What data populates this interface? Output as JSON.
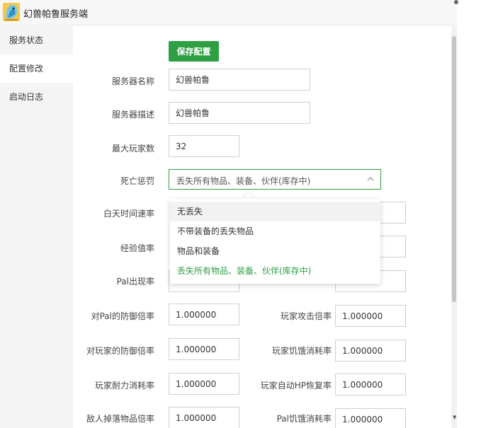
{
  "app": {
    "title": "幻兽帕鲁服务端"
  },
  "sidebar": {
    "items": [
      {
        "label": "服务状态"
      },
      {
        "label": "配置修改"
      },
      {
        "label": "启动日志"
      }
    ]
  },
  "toolbar": {
    "save_label": "保存配置"
  },
  "form": {
    "server_name": {
      "label": "服务器名称",
      "value": "幻兽帕鲁"
    },
    "server_desc": {
      "label": "服务器描述",
      "value": "幻兽帕鲁"
    },
    "max_players": {
      "label": "最大玩家数",
      "value": "32"
    },
    "death_penalty": {
      "label": "死亡惩罚",
      "value": "丢失所有物品、装备、伙伴(库存中)"
    },
    "day_speed": {
      "label": "白天时间速率"
    },
    "exp_rate": {
      "label": "经验值率"
    },
    "pal_spawn": {
      "label": "Pal出现率"
    },
    "pal_defense": {
      "label": "对Pal的防御倍率",
      "value": "1.000000"
    },
    "player_attack": {
      "label": "玩家攻击倍率",
      "value": "1.000000"
    },
    "player_defense": {
      "label": "对玩家的防御倍率",
      "value": "1.000000"
    },
    "player_hunger": {
      "label": "玩家饥饿消耗率",
      "value": "1.000000"
    },
    "player_stamina": {
      "label": "玩家耐力消耗率",
      "value": "1.000000"
    },
    "player_hp_regen": {
      "label": "玩家自动HP恢复率",
      "value": "1.000000"
    },
    "enemy_drop": {
      "label": "敌人掉落物品倍率",
      "value": "1.000000"
    },
    "pal_hunger": {
      "label": "Pal饥饿消耗率",
      "value": "1.000000"
    }
  },
  "dropdown": {
    "options": [
      {
        "label": "无丢失"
      },
      {
        "label": "不带装备的丢失物品"
      },
      {
        "label": "物品和装备"
      },
      {
        "label": "丢失所有物品、装备、伙伴(库存中)"
      }
    ]
  },
  "colors": {
    "accent": "#2ea043",
    "sidebar_bg": "#f4f4f4",
    "border": "#cfcfcf"
  }
}
